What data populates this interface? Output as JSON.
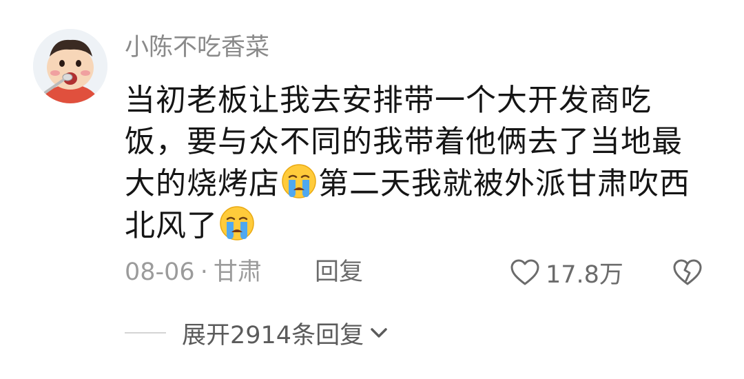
{
  "comment": {
    "username": "小陈不吃香菜",
    "text_part1": "当初老板让我去安排带一个大开发商吃饭，要与众不同的我带着他俩去了当地最大的烧烤店",
    "text_part2": "第二天我就被外派甘肃吹西北风了",
    "emoji_icon": "crying-face-icon",
    "date": "08-06",
    "separator": "·",
    "location": "甘肃",
    "reply_label": "回复",
    "like_count": "17.8万",
    "expand_label": "展开2914条回复"
  },
  "colors": {
    "username": "#8a8a8a",
    "body_text": "#151515",
    "meta_text": "#9b9b9b",
    "action_text": "#6b6b6b"
  }
}
